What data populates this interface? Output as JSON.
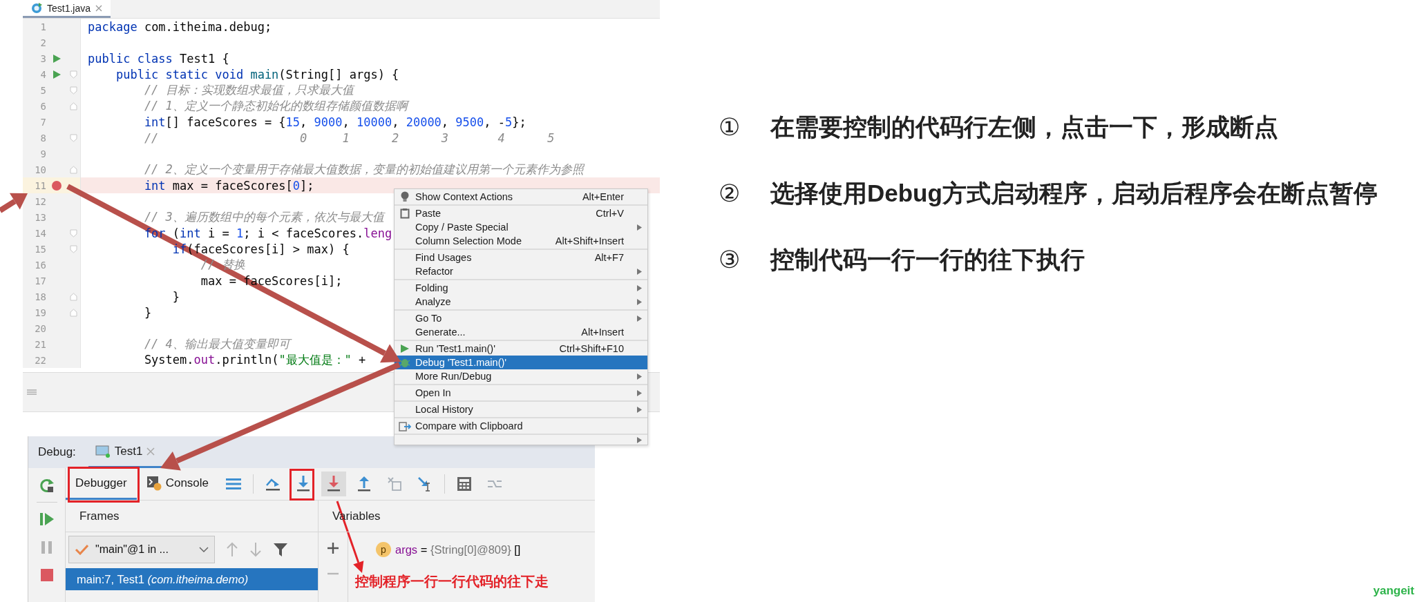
{
  "editor": {
    "tab": {
      "label": "Test1.java",
      "selected": true
    },
    "lines": [
      {
        "number": "1",
        "highlighted": false,
        "breakpoint": false,
        "runnable": false,
        "fold_start": false,
        "fold_end": false,
        "tokens": [
          {
            "kind": "keyword",
            "text": "package"
          },
          {
            "kind": "text",
            "text": " com.itheima.debug;"
          }
        ]
      },
      {
        "number": "2",
        "highlighted": false,
        "breakpoint": false,
        "runnable": false,
        "fold_start": false,
        "fold_end": false
      },
      {
        "number": "3",
        "highlighted": false,
        "breakpoint": false,
        "runnable": true,
        "fold_start": false,
        "fold_end": false,
        "tokens": [
          {
            "kind": "keyword",
            "text": "public class"
          },
          {
            "kind": "text",
            "text": " Test1 {"
          }
        ]
      },
      {
        "number": "4",
        "highlighted": false,
        "breakpoint": false,
        "runnable": true,
        "fold_start": true,
        "fold_end": false,
        "tokens": [
          {
            "kind": "keyword",
            "text": "    public static void "
          },
          {
            "kind": "method",
            "text": "main"
          },
          {
            "kind": "text",
            "text": "(String[] args) {"
          }
        ]
      },
      {
        "number": "5",
        "highlighted": false,
        "breakpoint": false,
        "runnable": false,
        "fold_start": true,
        "fold_end": false,
        "tokens": [
          {
            "kind": "comment",
            "text": "        // 目标：实现数组求最值，只求最大值"
          }
        ]
      },
      {
        "number": "6",
        "highlighted": false,
        "breakpoint": false,
        "runnable": false,
        "fold_start": false,
        "fold_end": true,
        "tokens": [
          {
            "kind": "comment",
            "text": "        // 1、定义一个静态初始化的数组存储颜值数据啊"
          }
        ]
      },
      {
        "number": "7",
        "highlighted": false,
        "breakpoint": false,
        "runnable": false,
        "fold_start": false,
        "fold_end": false,
        "tokens": [
          {
            "kind": "keyword",
            "text": "        int"
          },
          {
            "kind": "text",
            "text": "[] faceScores = {"
          },
          {
            "kind": "number",
            "text": "15"
          },
          {
            "kind": "text",
            "text": ", "
          },
          {
            "kind": "number",
            "text": "9000"
          },
          {
            "kind": "text",
            "text": ", "
          },
          {
            "kind": "number",
            "text": "10000"
          },
          {
            "kind": "text",
            "text": ", "
          },
          {
            "kind": "number",
            "text": "20000"
          },
          {
            "kind": "text",
            "text": ", "
          },
          {
            "kind": "number",
            "text": "9500"
          },
          {
            "kind": "text",
            "text": ", -"
          },
          {
            "kind": "number",
            "text": "5"
          },
          {
            "kind": "text",
            "text": "};"
          }
        ]
      },
      {
        "number": "8",
        "highlighted": false,
        "breakpoint": false,
        "runnable": false,
        "fold_start": true,
        "fold_end": false,
        "tokens": [
          {
            "kind": "comment",
            "text": "        //                    0     1      2      3       4      5"
          }
        ]
      },
      {
        "number": "9",
        "highlighted": false,
        "breakpoint": false,
        "runnable": false,
        "fold_start": false,
        "fold_end": false
      },
      {
        "number": "10",
        "highlighted": false,
        "breakpoint": false,
        "runnable": false,
        "fold_start": false,
        "fold_end": true,
        "tokens": [
          {
            "kind": "comment",
            "text": "        // 2、定义一个变量用于存储最大值数据，变量的初始值建议用第一个元素作为参照"
          }
        ]
      },
      {
        "number": "11",
        "highlighted": true,
        "breakpoint": true,
        "runnable": false,
        "fold_start": false,
        "fold_end": false,
        "tokens": [
          {
            "kind": "keyword",
            "text": "        int"
          },
          {
            "kind": "text",
            "text": " max = faceScores["
          },
          {
            "kind": "number",
            "text": "0"
          },
          {
            "kind": "text",
            "text": "];"
          }
        ]
      },
      {
        "number": "12",
        "highlighted": false,
        "breakpoint": false,
        "runnable": false,
        "fold_start": false,
        "fold_end": false
      },
      {
        "number": "13",
        "highlighted": false,
        "breakpoint": false,
        "runnable": false,
        "fold_start": false,
        "fold_end": false,
        "tokens": [
          {
            "kind": "comment",
            "text": "        // 3、遍历数组中的每个元素，依次与最大值"
          }
        ]
      },
      {
        "number": "14",
        "highlighted": false,
        "breakpoint": false,
        "runnable": false,
        "fold_start": true,
        "fold_end": false,
        "tokens": [
          {
            "kind": "keyword",
            "text": "        for"
          },
          {
            "kind": "text",
            "text": " ("
          },
          {
            "kind": "keyword",
            "text": "int"
          },
          {
            "kind": "text",
            "text": " i = "
          },
          {
            "kind": "number",
            "text": "1"
          },
          {
            "kind": "text",
            "text": "; i < faceScores."
          },
          {
            "kind": "field",
            "text": "leng"
          }
        ]
      },
      {
        "number": "15",
        "highlighted": false,
        "breakpoint": false,
        "runnable": false,
        "fold_start": true,
        "fold_end": false,
        "tokens": [
          {
            "kind": "keyword",
            "text": "            if"
          },
          {
            "kind": "text",
            "text": "(faceScores[i] > max) {"
          }
        ]
      },
      {
        "number": "16",
        "highlighted": false,
        "breakpoint": false,
        "runnable": false,
        "fold_start": false,
        "fold_end": false,
        "tokens": [
          {
            "kind": "comment",
            "text": "                // 替换"
          }
        ]
      },
      {
        "number": "17",
        "highlighted": false,
        "breakpoint": false,
        "runnable": false,
        "fold_start": false,
        "fold_end": false,
        "tokens": [
          {
            "kind": "text",
            "text": "                max = faceScores[i];"
          }
        ]
      },
      {
        "number": "18",
        "highlighted": false,
        "breakpoint": false,
        "runnable": false,
        "fold_start": false,
        "fold_end": true,
        "tokens": [
          {
            "kind": "text",
            "text": "            }"
          }
        ]
      },
      {
        "number": "19",
        "highlighted": false,
        "breakpoint": false,
        "runnable": false,
        "fold_start": false,
        "fold_end": true,
        "tokens": [
          {
            "kind": "text",
            "text": "        }"
          }
        ]
      },
      {
        "number": "20",
        "highlighted": false,
        "breakpoint": false,
        "runnable": false,
        "fold_start": false,
        "fold_end": false
      },
      {
        "number": "21",
        "highlighted": false,
        "breakpoint": false,
        "runnable": false,
        "fold_start": false,
        "fold_end": false,
        "tokens": [
          {
            "kind": "comment",
            "text": "        // 4、输出最大值变量即可"
          }
        ]
      },
      {
        "number": "22",
        "highlighted": false,
        "breakpoint": false,
        "runnable": false,
        "fold_start": false,
        "fold_end": false,
        "tokens": [
          {
            "kind": "text",
            "text": "        System."
          },
          {
            "kind": "field",
            "text": "out"
          },
          {
            "kind": "text",
            "text": ".println("
          },
          {
            "kind": "string",
            "text": "\"最大值是：\""
          },
          {
            "kind": "text",
            "text": " +"
          }
        ]
      }
    ]
  },
  "context_menu": {
    "groups": [
      {
        "items": [
          {
            "label": "Show Context Actions",
            "shortcut": "Alt+Enter",
            "kind": "bulb",
            "submenu": false,
            "selected": false
          }
        ]
      },
      {
        "items": [
          {
            "label": "Paste",
            "shortcut": "Ctrl+V",
            "kind": "clipboard",
            "submenu": false,
            "selected": false
          },
          {
            "label": "Copy / Paste Special",
            "kind": "plain",
            "submenu": true,
            "selected": false
          },
          {
            "label": "Column Selection Mode",
            "shortcut": "Alt+Shift+Insert",
            "kind": "plain",
            "submenu": false,
            "selected": false
          }
        ]
      },
      {
        "items": [
          {
            "label": "Find Usages",
            "shortcut": "Alt+F7",
            "kind": "plain",
            "submenu": false,
            "selected": false
          },
          {
            "label": "Refactor",
            "kind": "plain",
            "submenu": true,
            "selected": false
          }
        ]
      },
      {
        "items": [
          {
            "label": "Folding",
            "kind": "plain",
            "submenu": true,
            "selected": false
          },
          {
            "label": "Analyze",
            "kind": "plain",
            "submenu": true,
            "selected": false
          }
        ]
      },
      {
        "items": [
          {
            "label": "Go To",
            "kind": "plain",
            "submenu": true,
            "selected": false
          },
          {
            "label": "Generate...",
            "shortcut": "Alt+Insert",
            "kind": "plain",
            "submenu": false,
            "selected": false
          }
        ]
      },
      {
        "items": [
          {
            "label": "Run 'Test1.main()'",
            "shortcut": "Ctrl+Shift+F10",
            "kind": "run",
            "submenu": false,
            "selected": false
          },
          {
            "label": "Debug 'Test1.main()'",
            "kind": "debug",
            "submenu": false,
            "selected": true
          },
          {
            "label": "More Run/Debug",
            "kind": "plain",
            "submenu": true,
            "selected": false
          }
        ]
      },
      {
        "items": [
          {
            "label": "Open In",
            "kind": "plain",
            "submenu": true,
            "selected": false
          }
        ]
      },
      {
        "items": [
          {
            "label": "Local History",
            "kind": "plain",
            "submenu": true,
            "selected": false
          }
        ]
      },
      {
        "items": [
          {
            "label": "Compare with Clipboard",
            "kind": "compare",
            "submenu": false,
            "selected": false
          }
        ]
      },
      {
        "items": [
          {
            "kind": "plain",
            "submenu": true,
            "selected": false
          }
        ]
      }
    ]
  },
  "debug_panel": {
    "title": "Debug:",
    "session_tab": {
      "label": "Test1",
      "selected": true
    },
    "side_buttons": [
      {
        "kind": "resume",
        "disabled": false
      },
      {
        "kind": "pause",
        "disabled": true
      },
      {
        "kind": "stop",
        "disabled": false
      }
    ],
    "tabs": [
      {
        "label": "Debugger",
        "selected": true
      },
      {
        "label": "Console",
        "selected": false
      }
    ],
    "toolbar_groups": [
      [
        {
          "kind": "view-options",
          "disabled": false,
          "pressed": false
        }
      ],
      [
        {
          "kind": "step-over",
          "disabled": false,
          "pressed": false
        },
        {
          "kind": "step-into",
          "disabled": false,
          "pressed": false
        },
        {
          "kind": "force-step-into",
          "disabled": false,
          "pressed": true
        },
        {
          "kind": "step-out",
          "disabled": false,
          "pressed": false
        },
        {
          "kind": "drop-frame",
          "disabled": true,
          "pressed": false
        },
        {
          "kind": "run-to-cursor",
          "disabled": false,
          "pressed": false
        }
      ],
      [
        {
          "kind": "evaluate",
          "disabled": false,
          "pressed": false
        },
        {
          "kind": "trace",
          "disabled": true,
          "pressed": false
        }
      ]
    ],
    "frames": {
      "header": "Frames",
      "thread": "\"main\"@1 in ...",
      "items": [
        {
          "text": "main:7, Test1 *(com.itheima.demo)*",
          "selected": true
        }
      ]
    },
    "variables": {
      "header": "Variables",
      "items": [
        {
          "badge": "p",
          "name": "args",
          "operator": "=",
          "value": "{String[0]@809}",
          "extra": "[]"
        }
      ]
    },
    "annotation": "控制程序一行一行代码的往下走"
  },
  "steps": [
    {
      "marker": "①",
      "text": "在需要控制的代码行左侧，点击一下，形成断点"
    },
    {
      "marker": "②",
      "text": "选择使用Debug方式启动程序，启动后程序会在断点暂停"
    },
    {
      "marker": "③",
      "text": "控制代码一行一行的往下执行"
    }
  ],
  "logo": "yangeit"
}
